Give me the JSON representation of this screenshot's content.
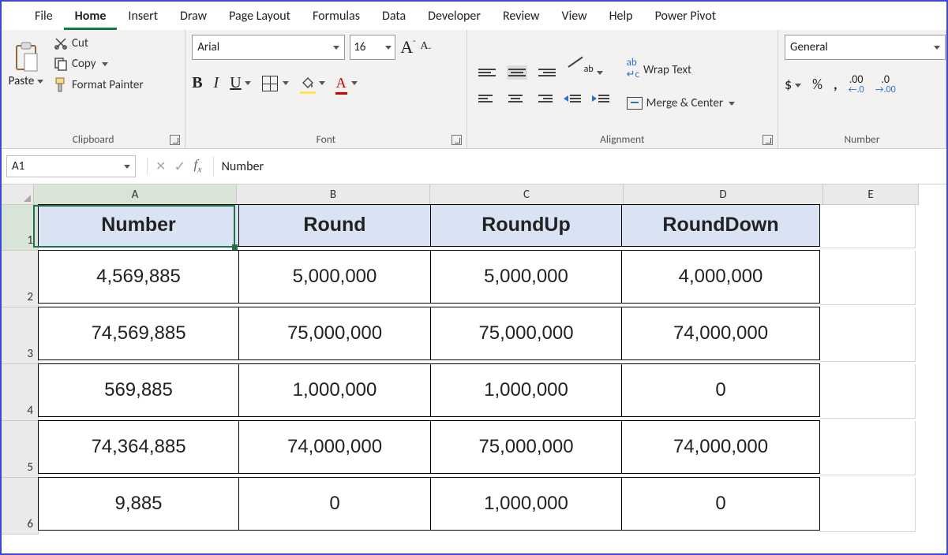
{
  "menu": {
    "items": [
      "File",
      "Home",
      "Insert",
      "Draw",
      "Page Layout",
      "Formulas",
      "Data",
      "Developer",
      "Review",
      "View",
      "Help",
      "Power Pivot"
    ],
    "active_index": 1
  },
  "ribbon": {
    "clipboard": {
      "paste": "Paste",
      "cut": "Cut",
      "copy": "Copy",
      "format_painter": "Format Painter",
      "group": "Clipboard"
    },
    "font": {
      "name": "Arial",
      "size": "16",
      "group": "Font"
    },
    "alignment": {
      "wrap_text": "Wrap Text",
      "merge_center": "Merge & Center",
      "group": "Alignment"
    },
    "number": {
      "format": "General",
      "group": "Number"
    }
  },
  "formula_bar": {
    "name_box": "A1",
    "content": "Number"
  },
  "grid": {
    "columns": [
      "A",
      "B",
      "C",
      "D",
      "E"
    ],
    "headers": [
      "Number",
      "Round",
      "RoundUp",
      "RoundDown"
    ],
    "rows": [
      [
        "4,569,885",
        "5,000,000",
        "5,000,000",
        "4,000,000"
      ],
      [
        "74,569,885",
        "75,000,000",
        "75,000,000",
        "74,000,000"
      ],
      [
        "569,885",
        "1,000,000",
        "1,000,000",
        "0"
      ],
      [
        "74,364,885",
        "74,000,000",
        "75,000,000",
        "74,000,000"
      ],
      [
        "9,885",
        "0",
        "1,000,000",
        "0"
      ]
    ],
    "selected_cell": "A1"
  }
}
